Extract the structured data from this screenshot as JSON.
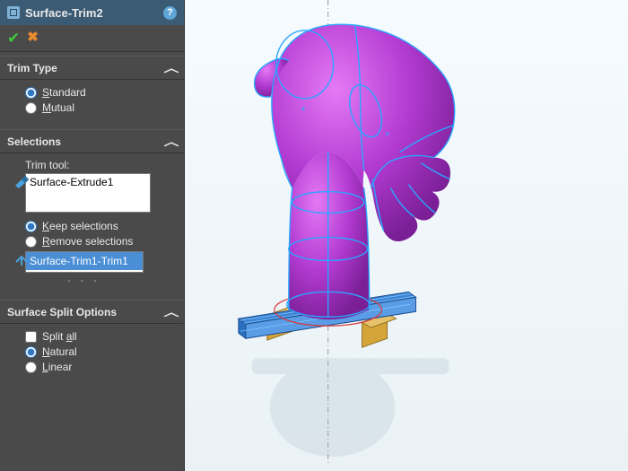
{
  "header": {
    "title": "Surface-Trim2"
  },
  "toolbar": {
    "ok": "✔",
    "cancel": "✖"
  },
  "trimType": {
    "title": "Trim Type",
    "standard": "tandard",
    "standard_u": "S",
    "mutual": "utual",
    "mutual_u": "M"
  },
  "selections": {
    "title": "Selections",
    "trimToolLabel": "Trim tool:",
    "trimToolItems": [
      "Surface-Extrude1"
    ],
    "keep": "eep selections",
    "keep_u": "K",
    "remove": "emove selections",
    "remove_u": "R",
    "resultItems": [
      "Surface-Trim1-Trim1"
    ]
  },
  "splitOptions": {
    "title": "Surface Split Options",
    "splitAll": "Split ",
    "splitAll_u": "a",
    "splitAll2": "ll",
    "natural": "atural",
    "natural_u": "N",
    "linear": "inear",
    "linear_u": "L"
  },
  "colors": {
    "panel": "#4a4a4a",
    "accent": "#2f79c4",
    "modelBody": "#b23ad1",
    "modelWire": "#2aa6ff",
    "rail": "#2a6fd6",
    "clip": "#d6a53a"
  }
}
